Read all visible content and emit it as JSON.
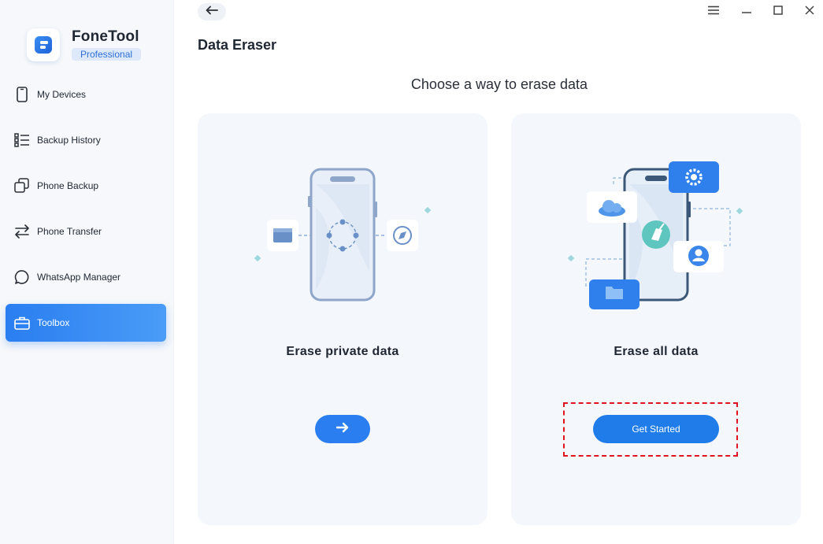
{
  "app": {
    "name": "FoneTool",
    "edition": "Professional"
  },
  "sidebar": {
    "items": [
      {
        "label": "My Devices",
        "icon": "phone-icon",
        "active": false
      },
      {
        "label": "Backup History",
        "icon": "list-icon",
        "active": false
      },
      {
        "label": "Phone Backup",
        "icon": "copy-icon",
        "active": false
      },
      {
        "label": "Phone Transfer",
        "icon": "transfer-icon",
        "active": false
      },
      {
        "label": "WhatsApp Manager",
        "icon": "chat-icon",
        "active": false
      },
      {
        "label": "Toolbox",
        "icon": "toolbox-icon",
        "active": true
      }
    ]
  },
  "header": {
    "back_icon": "arrow-left-icon",
    "window_controls": [
      "menu-icon",
      "minimize-icon",
      "maximize-icon",
      "close-icon"
    ]
  },
  "main": {
    "title": "Data Eraser",
    "subtitle": "Choose a way to erase data",
    "cards": [
      {
        "title": "Erase private data",
        "action_icon": "arrow-right-icon"
      },
      {
        "title": "Erase all data",
        "action_label": "Get Started",
        "highlighted": true
      }
    ]
  },
  "colors": {
    "accent": "#2a7ef0",
    "highlight_border": "#e0141e",
    "card_bg": "#f4f7fc"
  }
}
